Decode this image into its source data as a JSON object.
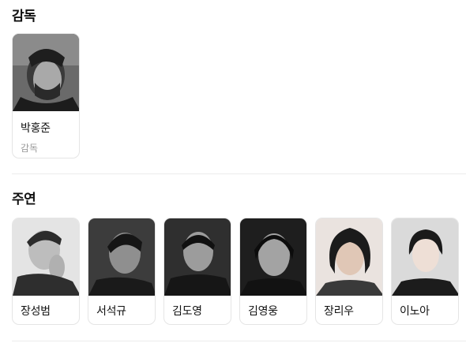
{
  "sections": {
    "director": {
      "title": "감독",
      "people": [
        {
          "name": "박홍준",
          "role": "감독"
        }
      ]
    },
    "cast": {
      "title": "주연",
      "people": [
        {
          "name": "장성범"
        },
        {
          "name": "서석규"
        },
        {
          "name": "김도영"
        },
        {
          "name": "김영웅"
        },
        {
          "name": "장리우"
        },
        {
          "name": "이노아"
        }
      ]
    }
  }
}
